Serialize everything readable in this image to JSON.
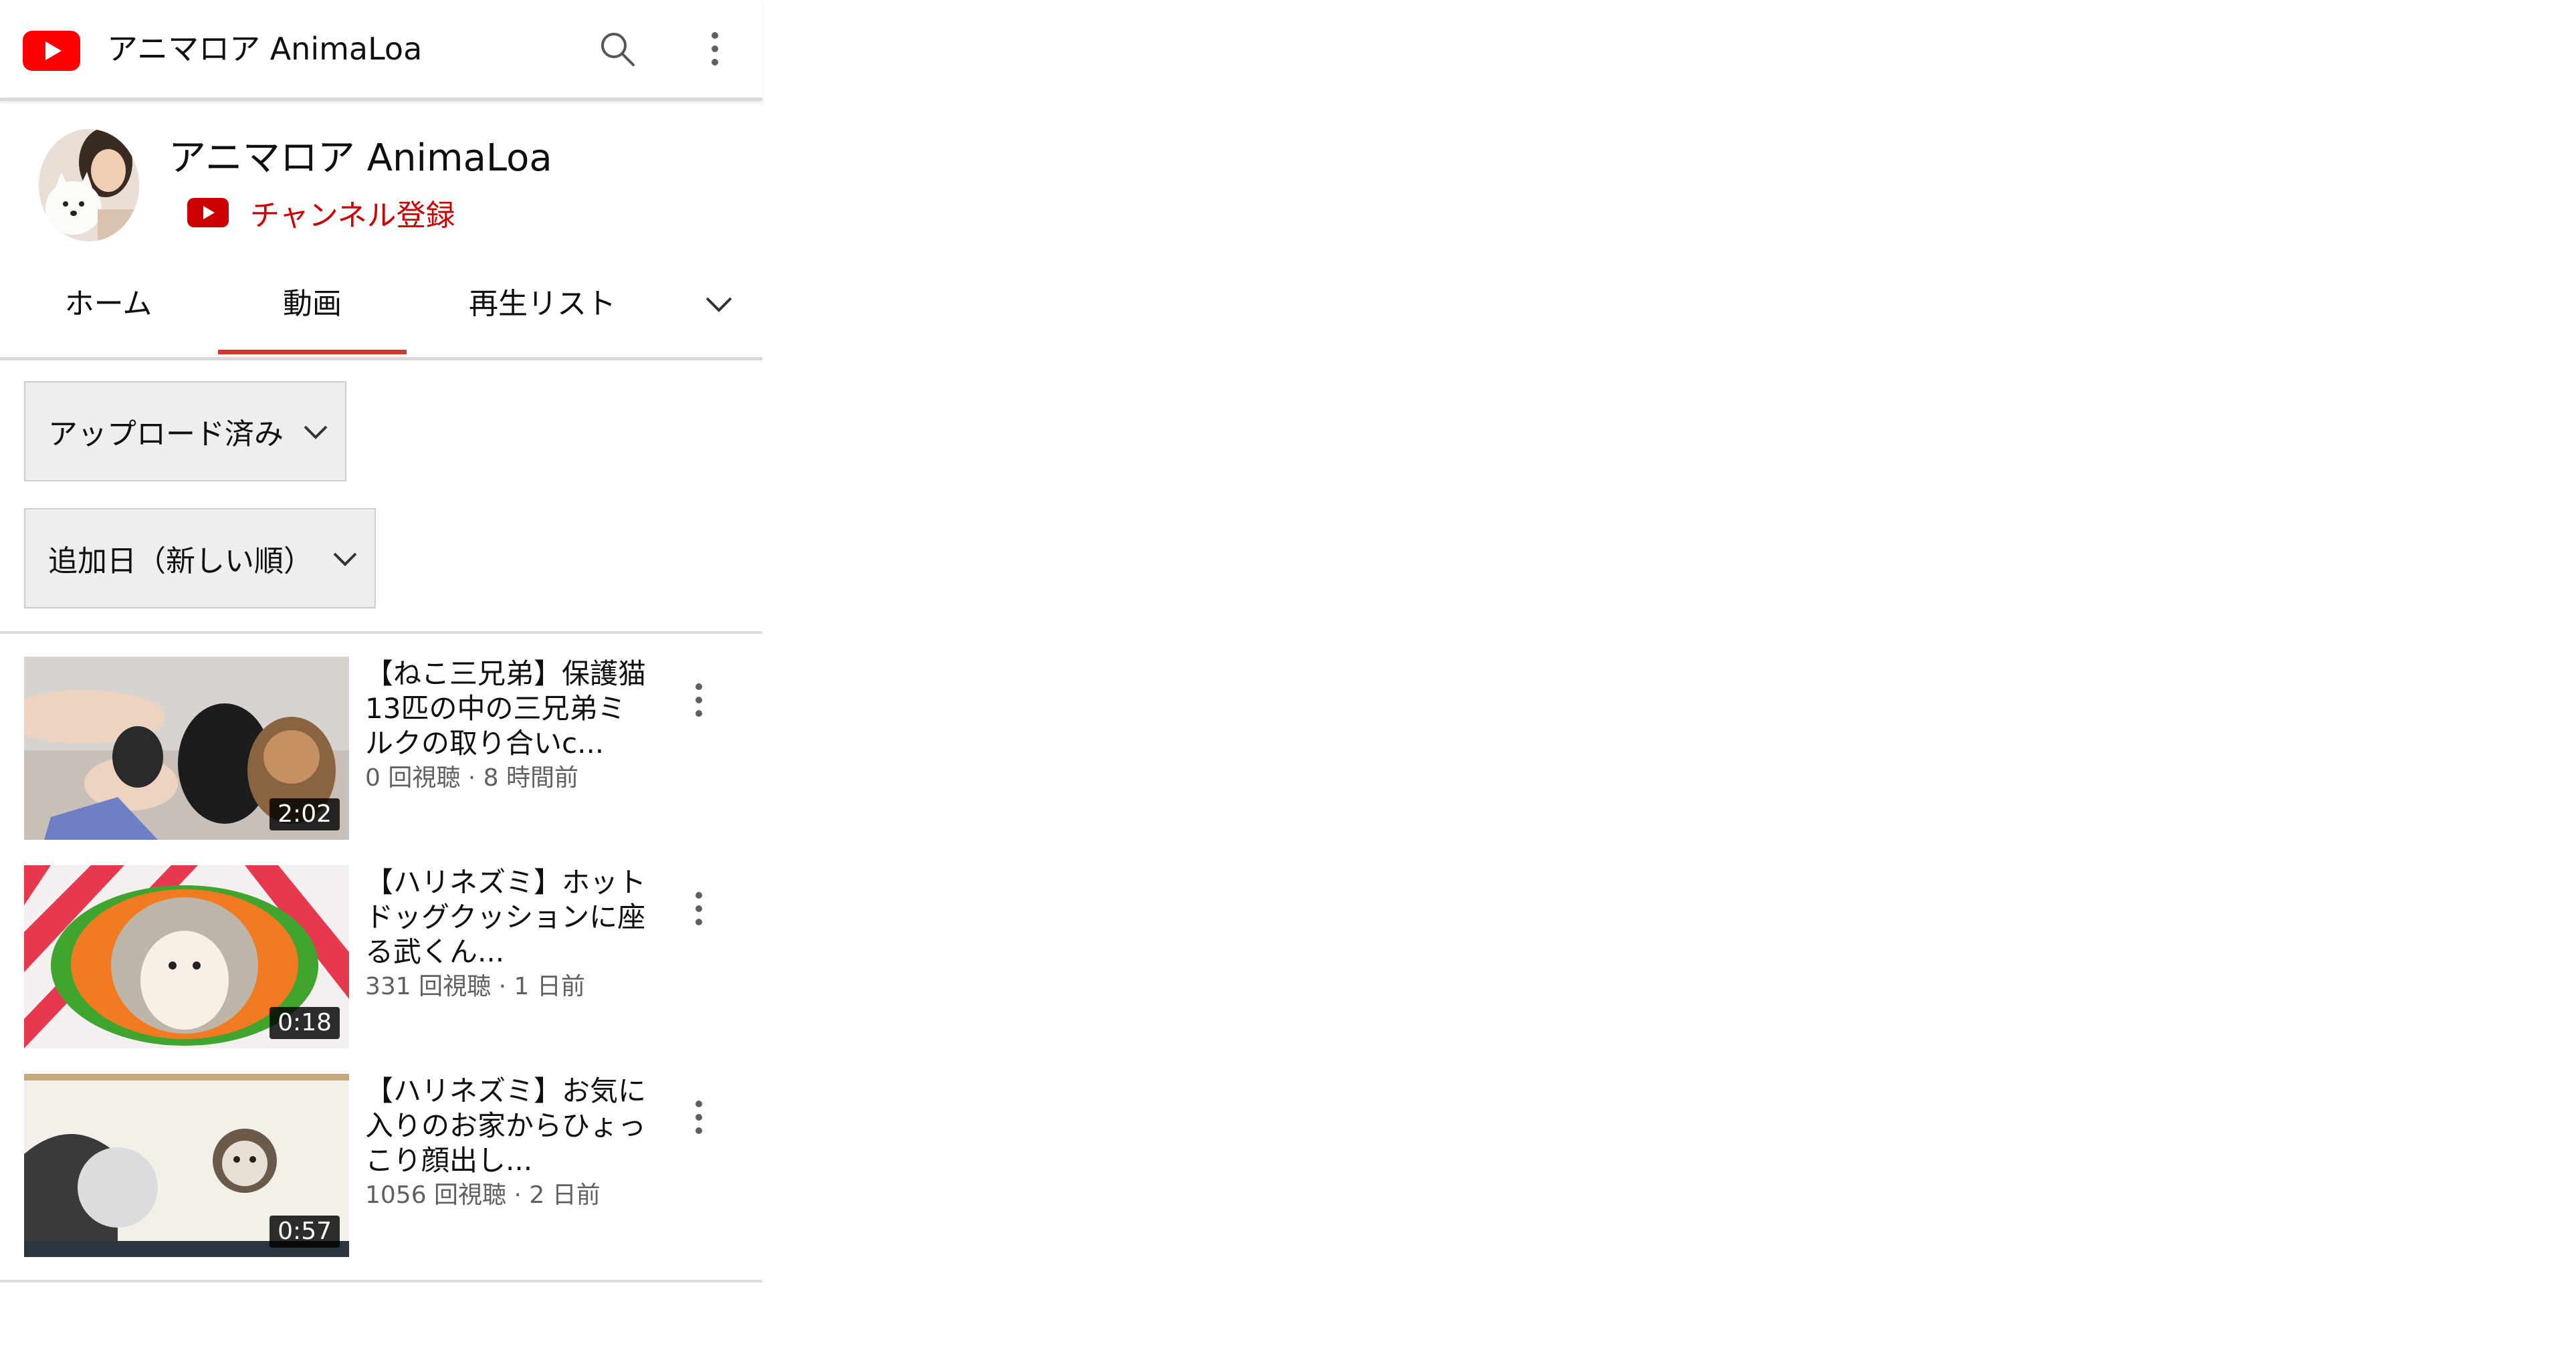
{
  "topbar": {
    "title": "アニマロア AnimaLoa",
    "logo_icon": "youtube-logo",
    "search_icon": "search-icon",
    "more_icon": "more-vert-icon"
  },
  "channel": {
    "name": "アニマロア AnimaLoa",
    "avatar_icon": "channel-avatar",
    "subscribe_label": "チャンネル登録",
    "subscribe_color": "#cc0000"
  },
  "tabs": [
    {
      "label": "ホーム",
      "active": false
    },
    {
      "label": "動画",
      "active": true
    },
    {
      "label": "再生リスト",
      "active": false
    }
  ],
  "tabs_more_icon": "chevron-down-icon",
  "filters": {
    "upload_filter": "アップロード済み",
    "sort_filter": "追加日（新しい順）"
  },
  "videos": [
    {
      "title": "【ねこ三兄弟】保護猫13匹の中の三兄弟ミルクの取り合いc...",
      "meta": "0 回視聴 · 8 時間前",
      "duration": "2:02"
    },
    {
      "title": "【ハリネズミ】ホットドッグクッションに座る武くん...",
      "meta": "331 回視聴 · 1 日前",
      "duration": "0:18"
    },
    {
      "title": "【ハリネズミ】お気に入りのお家からひょっこり顔出し...",
      "meta": "1056 回視聴 · 2 日前",
      "duration": "0:57"
    }
  ],
  "colors": {
    "accent": "#e0322c",
    "youtube_red": "#ff0000",
    "meta_gray": "#606060"
  }
}
